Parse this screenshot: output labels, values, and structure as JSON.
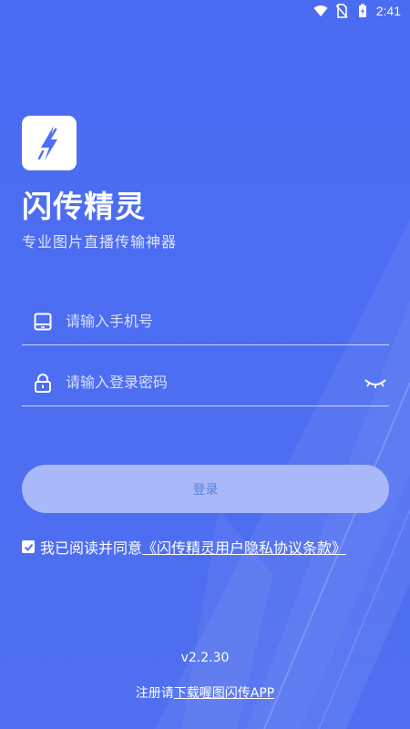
{
  "status_bar": {
    "time": "2:41",
    "icons": [
      "wifi-icon",
      "no-sim-icon",
      "battery-charging-icon"
    ]
  },
  "app": {
    "logo_icon": "lightning-bolt-icon",
    "title": "闪传精灵",
    "subtitle": "专业图片直播传输神器"
  },
  "form": {
    "phone": {
      "placeholder": "请输入手机号",
      "value": "",
      "icon": "phone-icon"
    },
    "password": {
      "placeholder": "请输入登录密码",
      "value": "",
      "icon": "lock-icon",
      "toggle_icon": "eye-closed-icon"
    },
    "login_label": "登录"
  },
  "agreement": {
    "checked": true,
    "prefix": "我已阅读并同意",
    "link_text": "《闪传精灵用户隐私协议条款》"
  },
  "footer": {
    "version": "v2.2.30",
    "register_prefix": "注册请",
    "register_link": "下载喔图闪传APP"
  },
  "colors": {
    "background": "#4f6ef2",
    "button_bg": "#a9b8f8",
    "button_text": "#5a83d9",
    "logo_accent": "#4f6ef2"
  }
}
